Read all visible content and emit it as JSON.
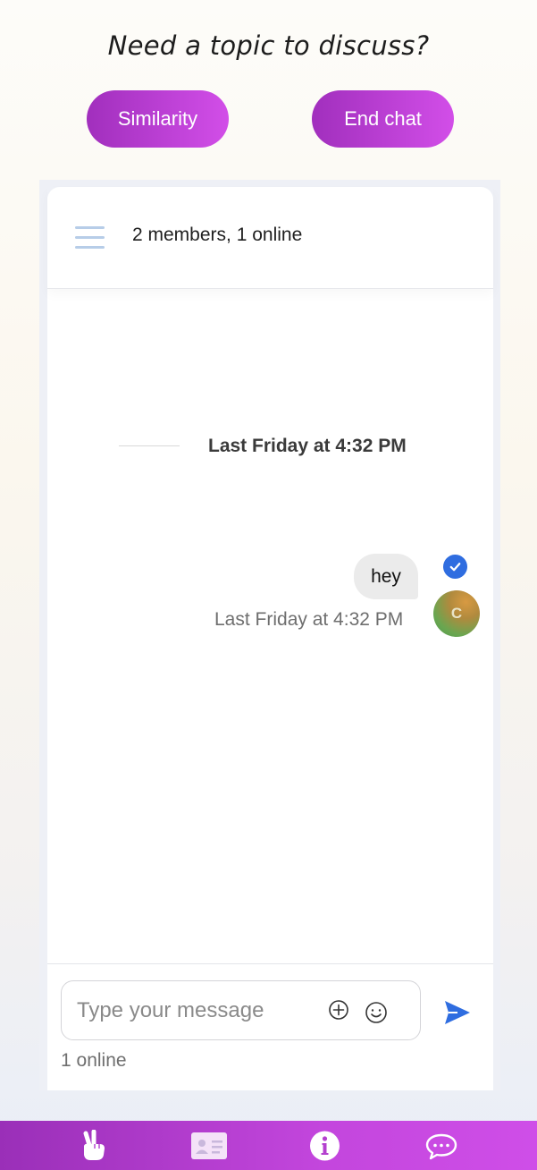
{
  "prompt": "Need a topic to discuss?",
  "actions": {
    "similarity_label": "Similarity",
    "end_chat_label": "End chat"
  },
  "chat": {
    "header": {
      "members_status": "2 members, 1 online"
    },
    "date_separator": "Last Friday at 4:32 PM",
    "messages": [
      {
        "text": "hey",
        "time": "Last Friday at 4:32 PM",
        "avatar_initial": "C",
        "read": true
      }
    ],
    "composer": {
      "placeholder": "Type your message",
      "value": ""
    },
    "online_status": "1 online"
  },
  "bottom_nav": {
    "items": [
      "hand-peace-icon",
      "id-card-icon",
      "info-icon",
      "chat-bubble-icon"
    ]
  },
  "colors": {
    "accent_start": "#a12fbd",
    "accent_end": "#d24ee8",
    "send_blue": "#2f6de0",
    "read_check": "#2f6de0"
  }
}
